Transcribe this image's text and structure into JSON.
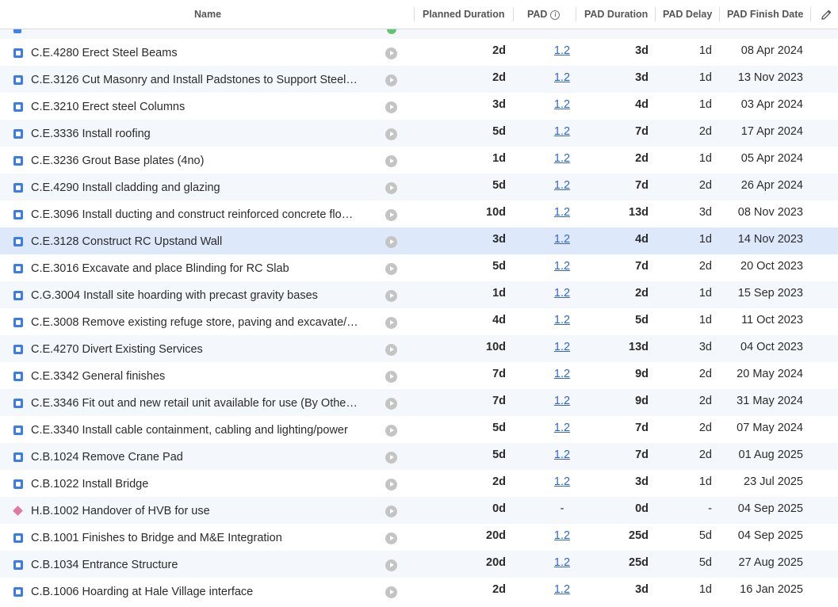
{
  "header": {
    "name": "Name",
    "planned_duration": "Planned Duration",
    "pad": "PAD",
    "pad_info_icon": "info-icon",
    "pad_duration": "PAD Duration",
    "pad_delay": "PAD Delay",
    "pad_finish_date": "PAD Finish Date",
    "edit_icon": "pencil-icon"
  },
  "colors": {
    "activity_icon": "#3b7bea",
    "milestone_icon": "#e07aa4",
    "link": "#3366cc",
    "selected_row": "#dde9fb",
    "alt_row": "#f4f7fb"
  },
  "rows": [
    {
      "type": "activity",
      "name": "C.E.4280 Erect Steel Beams",
      "planned": "2d",
      "pad": "1.2",
      "pad_duration": "3d",
      "delay": "1d",
      "finish": "08 Apr 2024"
    },
    {
      "type": "activity",
      "name": "C.E.3126 Cut Masonry and Install Padstones to Support Steel…",
      "planned": "2d",
      "pad": "1.2",
      "pad_duration": "3d",
      "delay": "1d",
      "finish": "13 Nov 2023"
    },
    {
      "type": "activity",
      "name": "C.E.3210 Erect steel Columns",
      "planned": "3d",
      "pad": "1.2",
      "pad_duration": "4d",
      "delay": "1d",
      "finish": "03 Apr 2024"
    },
    {
      "type": "activity",
      "name": "C.E.3336 Install roofing",
      "planned": "5d",
      "pad": "1.2",
      "pad_duration": "7d",
      "delay": "2d",
      "finish": "17 Apr 2024"
    },
    {
      "type": "activity",
      "name": "C.E.3236 Grout Base plates (4no)",
      "planned": "1d",
      "pad": "1.2",
      "pad_duration": "2d",
      "delay": "1d",
      "finish": "05 Apr 2024"
    },
    {
      "type": "activity",
      "name": "C.E.4290 Install cladding and glazing",
      "planned": "5d",
      "pad": "1.2",
      "pad_duration": "7d",
      "delay": "2d",
      "finish": "26 Apr 2024"
    },
    {
      "type": "activity",
      "name": "C.E.3096 Install ducting and construct reinforced concrete flo…",
      "planned": "10d",
      "pad": "1.2",
      "pad_duration": "13d",
      "delay": "3d",
      "finish": "08 Nov 2023"
    },
    {
      "type": "activity",
      "name": "C.E.3128 Construct RC Upstand Wall",
      "planned": "3d",
      "pad": "1.2",
      "pad_duration": "4d",
      "delay": "1d",
      "finish": "14 Nov 2023",
      "selected": true
    },
    {
      "type": "activity",
      "name": "C.E.3016 Excavate and place Blinding for RC Slab",
      "planned": "5d",
      "pad": "1.2",
      "pad_duration": "7d",
      "delay": "2d",
      "finish": "20 Oct 2023"
    },
    {
      "type": "activity",
      "name": "C.G.3004 Install site hoarding with precast gravity bases",
      "planned": "1d",
      "pad": "1.2",
      "pad_duration": "2d",
      "delay": "1d",
      "finish": "15 Sep 2023"
    },
    {
      "type": "activity",
      "name": "C.E.3008 Remove existing refuge store, paving and excavate/…",
      "planned": "4d",
      "pad": "1.2",
      "pad_duration": "5d",
      "delay": "1d",
      "finish": "11 Oct 2023"
    },
    {
      "type": "activity",
      "name": "C.E.4270 Divert Existing Services",
      "planned": "10d",
      "pad": "1.2",
      "pad_duration": "13d",
      "delay": "3d",
      "finish": "04 Oct 2023"
    },
    {
      "type": "activity",
      "name": "C.E.3342 General finishes",
      "planned": "7d",
      "pad": "1.2",
      "pad_duration": "9d",
      "delay": "2d",
      "finish": "20 May 2024"
    },
    {
      "type": "activity",
      "name": "C.E.3346 Fit out and new retail unit available for use (By Othe…",
      "planned": "7d",
      "pad": "1.2",
      "pad_duration": "9d",
      "delay": "2d",
      "finish": "31 May 2024"
    },
    {
      "type": "activity",
      "name": "C.E.3340 Install cable containment, cabling and lighting/power",
      "planned": "5d",
      "pad": "1.2",
      "pad_duration": "7d",
      "delay": "2d",
      "finish": "07 May 2024"
    },
    {
      "type": "activity",
      "name": "C.B.1024 Remove Crane Pad",
      "planned": "5d",
      "pad": "1.2",
      "pad_duration": "7d",
      "delay": "2d",
      "finish": "01 Aug 2025"
    },
    {
      "type": "activity",
      "name": "C.B.1022 Install Bridge",
      "planned": "2d",
      "pad": "1.2",
      "pad_duration": "3d",
      "delay": "1d",
      "finish": "23 Jul 2025"
    },
    {
      "type": "milestone",
      "name": "H.B.1002 Handover of HVB for use",
      "planned": "0d",
      "pad": "-",
      "pad_duration": "0d",
      "delay": "-",
      "finish": "04 Sep 2025"
    },
    {
      "type": "activity",
      "name": "C.B.1001 Finishes to Bridge and M&E Integration",
      "planned": "20d",
      "pad": "1.2",
      "pad_duration": "25d",
      "delay": "5d",
      "finish": "04 Sep 2025"
    },
    {
      "type": "activity",
      "name": "C.B.1034 Entrance Structure",
      "planned": "20d",
      "pad": "1.2",
      "pad_duration": "25d",
      "delay": "5d",
      "finish": "27 Aug 2025"
    },
    {
      "type": "activity",
      "name": "C.B.1006 Hoarding at Hale Village interface",
      "planned": "2d",
      "pad": "1.2",
      "pad_duration": "3d",
      "delay": "1d",
      "finish": "16 Jan 2025"
    }
  ]
}
